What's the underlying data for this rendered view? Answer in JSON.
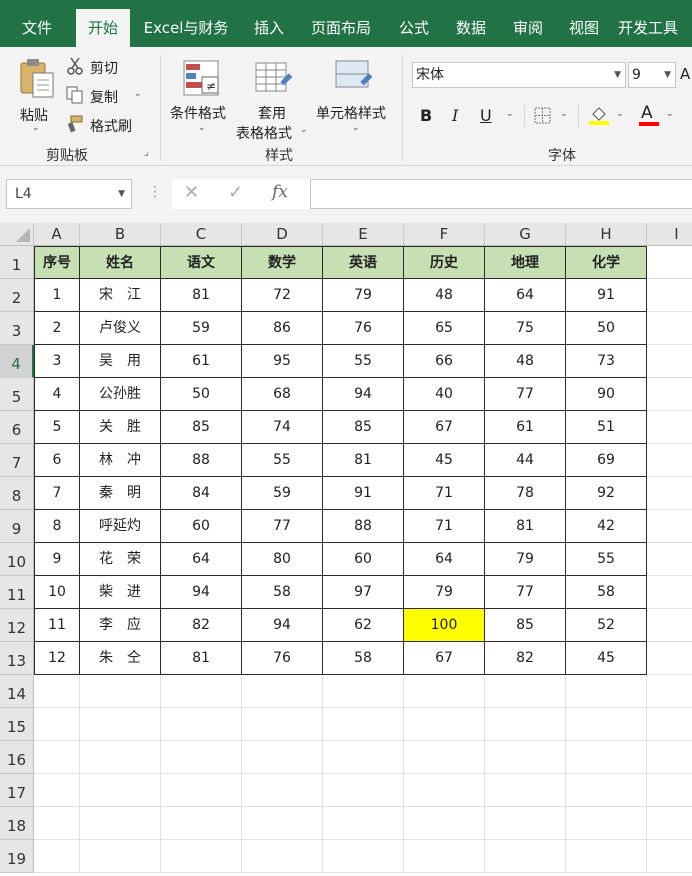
{
  "menu": {
    "tabs": [
      "文件",
      "开始",
      "Excel与财务",
      "插入",
      "页面布局",
      "公式",
      "数据",
      "审阅",
      "视图",
      "开发工具"
    ],
    "active": "开始"
  },
  "ribbon": {
    "clipboard": {
      "paste": "粘贴",
      "cut": "剪切",
      "copy": "复制",
      "format_painter": "格式刷",
      "group_label": "剪贴板"
    },
    "styles": {
      "conditional_format": "条件格式",
      "table_format_line1": "套用",
      "table_format_line2": "表格格式",
      "cell_styles": "单元格样式",
      "group_label": "样式"
    },
    "font": {
      "font_name": "宋体",
      "font_size": "9",
      "bold": "B",
      "italic": "I",
      "underline": "U",
      "font_color_glyph": "A",
      "group_label": "字体"
    }
  },
  "formula_bar": {
    "name_box": "L4",
    "fx": "fx",
    "formula": ""
  },
  "sheet": {
    "column_letters": [
      "A",
      "B",
      "C",
      "D",
      "E",
      "F",
      "G",
      "H",
      "I"
    ],
    "row_numbers": [
      "1",
      "2",
      "3",
      "4",
      "5",
      "6",
      "7",
      "8",
      "9",
      "10",
      "11",
      "12",
      "13",
      "14",
      "15",
      "16",
      "17",
      "18",
      "19"
    ],
    "headers": [
      "序号",
      "姓名",
      "语文",
      "数学",
      "英语",
      "历史",
      "地理",
      "化学"
    ],
    "rows": [
      [
        "1",
        "宋　江",
        "81",
        "72",
        "79",
        "48",
        "64",
        "91"
      ],
      [
        "2",
        "卢俊义",
        "59",
        "86",
        "76",
        "65",
        "75",
        "50"
      ],
      [
        "3",
        "吴　用",
        "61",
        "95",
        "55",
        "66",
        "48",
        "73"
      ],
      [
        "4",
        "公孙胜",
        "50",
        "68",
        "94",
        "40",
        "77",
        "90"
      ],
      [
        "5",
        "关　胜",
        "85",
        "74",
        "85",
        "67",
        "61",
        "51"
      ],
      [
        "6",
        "林　冲",
        "88",
        "55",
        "81",
        "45",
        "44",
        "69"
      ],
      [
        "7",
        "秦　明",
        "84",
        "59",
        "91",
        "71",
        "78",
        "92"
      ],
      [
        "8",
        "呼延灼",
        "60",
        "77",
        "88",
        "71",
        "81",
        "42"
      ],
      [
        "9",
        "花　荣",
        "64",
        "80",
        "60",
        "64",
        "79",
        "55"
      ],
      [
        "10",
        "柴　进",
        "94",
        "58",
        "97",
        "79",
        "77",
        "58"
      ],
      [
        "11",
        "李　应",
        "82",
        "94",
        "62",
        "100",
        "85",
        "52"
      ],
      [
        "12",
        "朱　仝",
        "81",
        "76",
        "58",
        "67",
        "82",
        "45"
      ]
    ],
    "highlight": {
      "row": 10,
      "col": 5,
      "color": "#ffff00"
    },
    "header_fill": "#c6e0b4",
    "selected_row": "4"
  },
  "colors": {
    "menubar": "#217346",
    "ribbon": "#f3f3f3"
  }
}
